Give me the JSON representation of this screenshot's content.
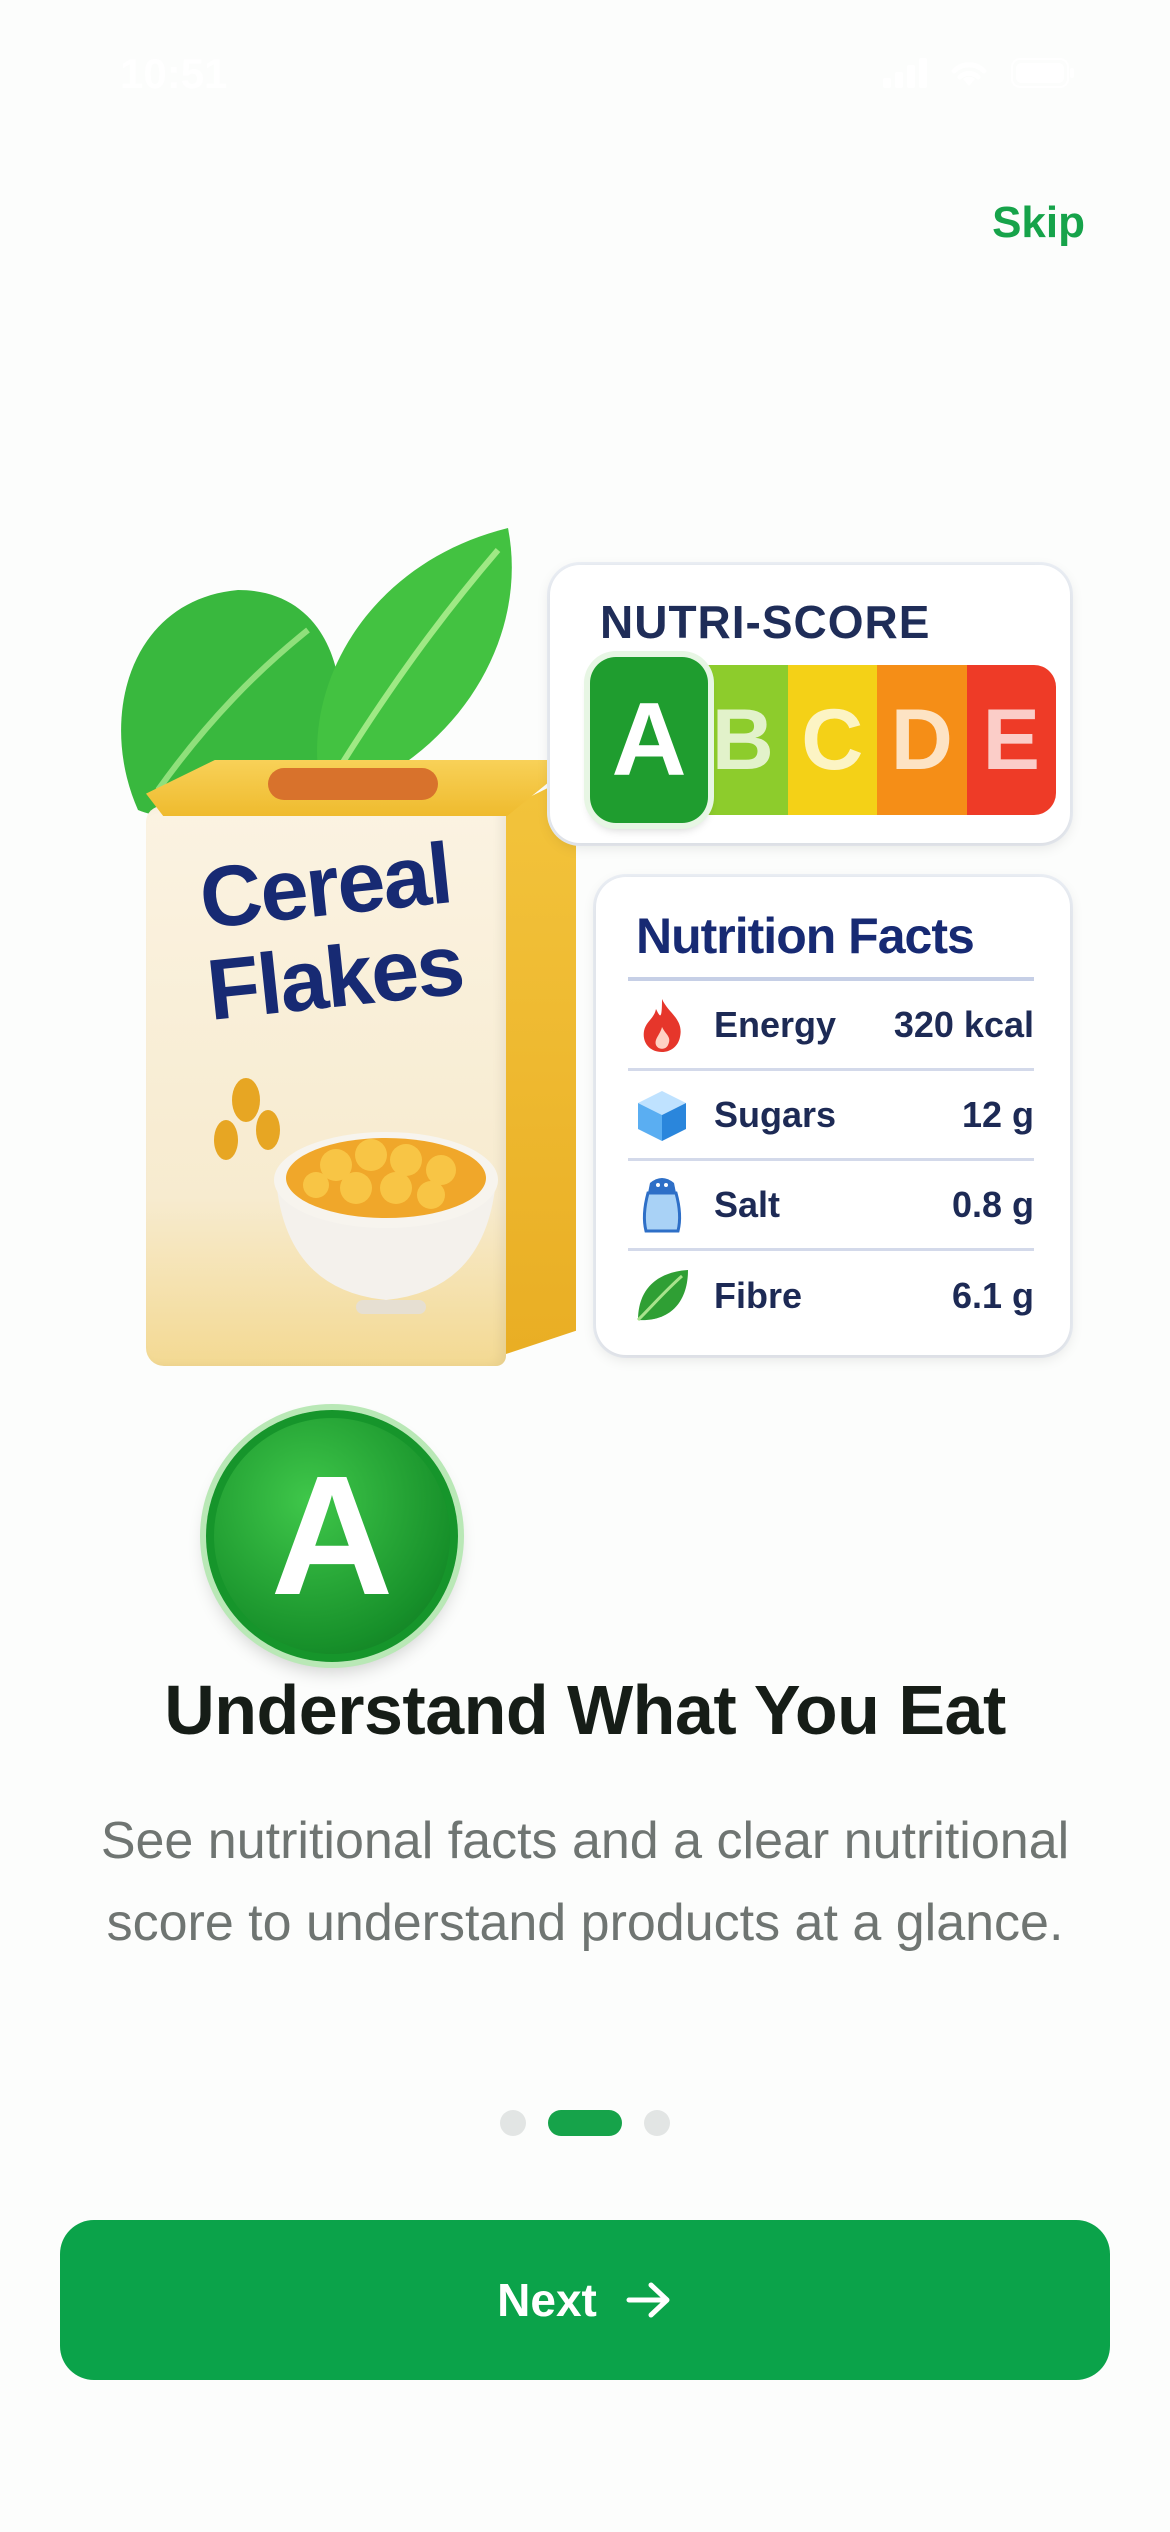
{
  "status_bar": {
    "time": "10:51"
  },
  "header": {
    "skip_label": "Skip"
  },
  "illustration": {
    "box_title_line1": "Cereal",
    "box_title_line2": "Flakes",
    "box_badge_grade": "A",
    "nutri_score": {
      "title": "NUTRI-SCORE",
      "active_grade": "A",
      "grades": [
        {
          "letter": "A",
          "color": "#1f9d2f"
        },
        {
          "letter": "B",
          "color": "#8dcc2c"
        },
        {
          "letter": "C",
          "color": "#f4d117"
        },
        {
          "letter": "D",
          "color": "#f58e17"
        },
        {
          "letter": "E",
          "color": "#ee3b27"
        }
      ]
    },
    "nutrition_facts": {
      "title": "Nutrition Facts",
      "rows": [
        {
          "icon": "flame-icon",
          "label": "Energy",
          "value": "320 kcal"
        },
        {
          "icon": "sugar-cube-icon",
          "label": "Sugars",
          "value": "12 g"
        },
        {
          "icon": "salt-shaker-icon",
          "label": "Salt",
          "value": "0.8 g"
        },
        {
          "icon": "leaf-icon",
          "label": "Fibre",
          "value": "6.1 g"
        }
      ]
    }
  },
  "content": {
    "headline": "Understand What You Eat",
    "subtitle": "See nutritional facts and a clear nutritional score to understand products at a glance."
  },
  "pagination": {
    "total": 3,
    "active_index": 2
  },
  "footer": {
    "next_label": "Next"
  },
  "colors": {
    "accent": "#16a34a",
    "button": "#0ba34a"
  }
}
